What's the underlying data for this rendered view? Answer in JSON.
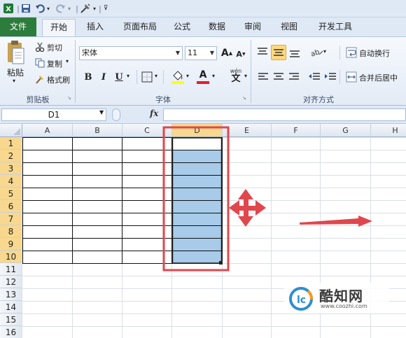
{
  "quick_access": {
    "app_icon": "excel-icon",
    "save_icon": "save-icon",
    "undo_icon": "undo-icon",
    "redo_icon": "redo-icon",
    "format_icon": "format-painter-icon"
  },
  "tabs": [
    {
      "label": "文件",
      "active": false
    },
    {
      "label": "开始",
      "active": true
    },
    {
      "label": "插入"
    },
    {
      "label": "页面布局"
    },
    {
      "label": "公式"
    },
    {
      "label": "数据"
    },
    {
      "label": "审阅"
    },
    {
      "label": "视图"
    },
    {
      "label": "开发工具"
    }
  ],
  "clipboard": {
    "paste": "粘贴",
    "cut": "剪切",
    "copy": "复制",
    "format_painter": "格式刷",
    "group": "剪贴板"
  },
  "font": {
    "name": "宋体",
    "size": "11",
    "bold": "B",
    "italic": "I",
    "underline": "U",
    "grow": "A",
    "shrink": "A",
    "color_letter": "A",
    "wen": "wén",
    "wen_char": "文",
    "group": "字体"
  },
  "alignment": {
    "wrap": "自动换行",
    "merge": "合并后居中",
    "group": "对齐方式"
  },
  "formula_bar": {
    "name_box": "D1",
    "fx": "fx",
    "value": ""
  },
  "columns": [
    "A",
    "B",
    "C",
    "D",
    "E",
    "F",
    "G",
    "H"
  ],
  "rows": [
    "1",
    "2",
    "3",
    "4",
    "5",
    "6",
    "7",
    "8",
    "9",
    "10",
    "11",
    "12",
    "13",
    "14",
    "15",
    "16"
  ],
  "selection": {
    "column": "D",
    "first_row": "1",
    "last_row": "10"
  },
  "watermark": {
    "brand": "酷知网",
    "url": "www.coozhi.com"
  },
  "colors": {
    "file_tab": "#2c7c3b",
    "selection_fill": "#a7cbe9",
    "selected_header": "#f8d88e",
    "annotation_red": "#e0474c"
  }
}
